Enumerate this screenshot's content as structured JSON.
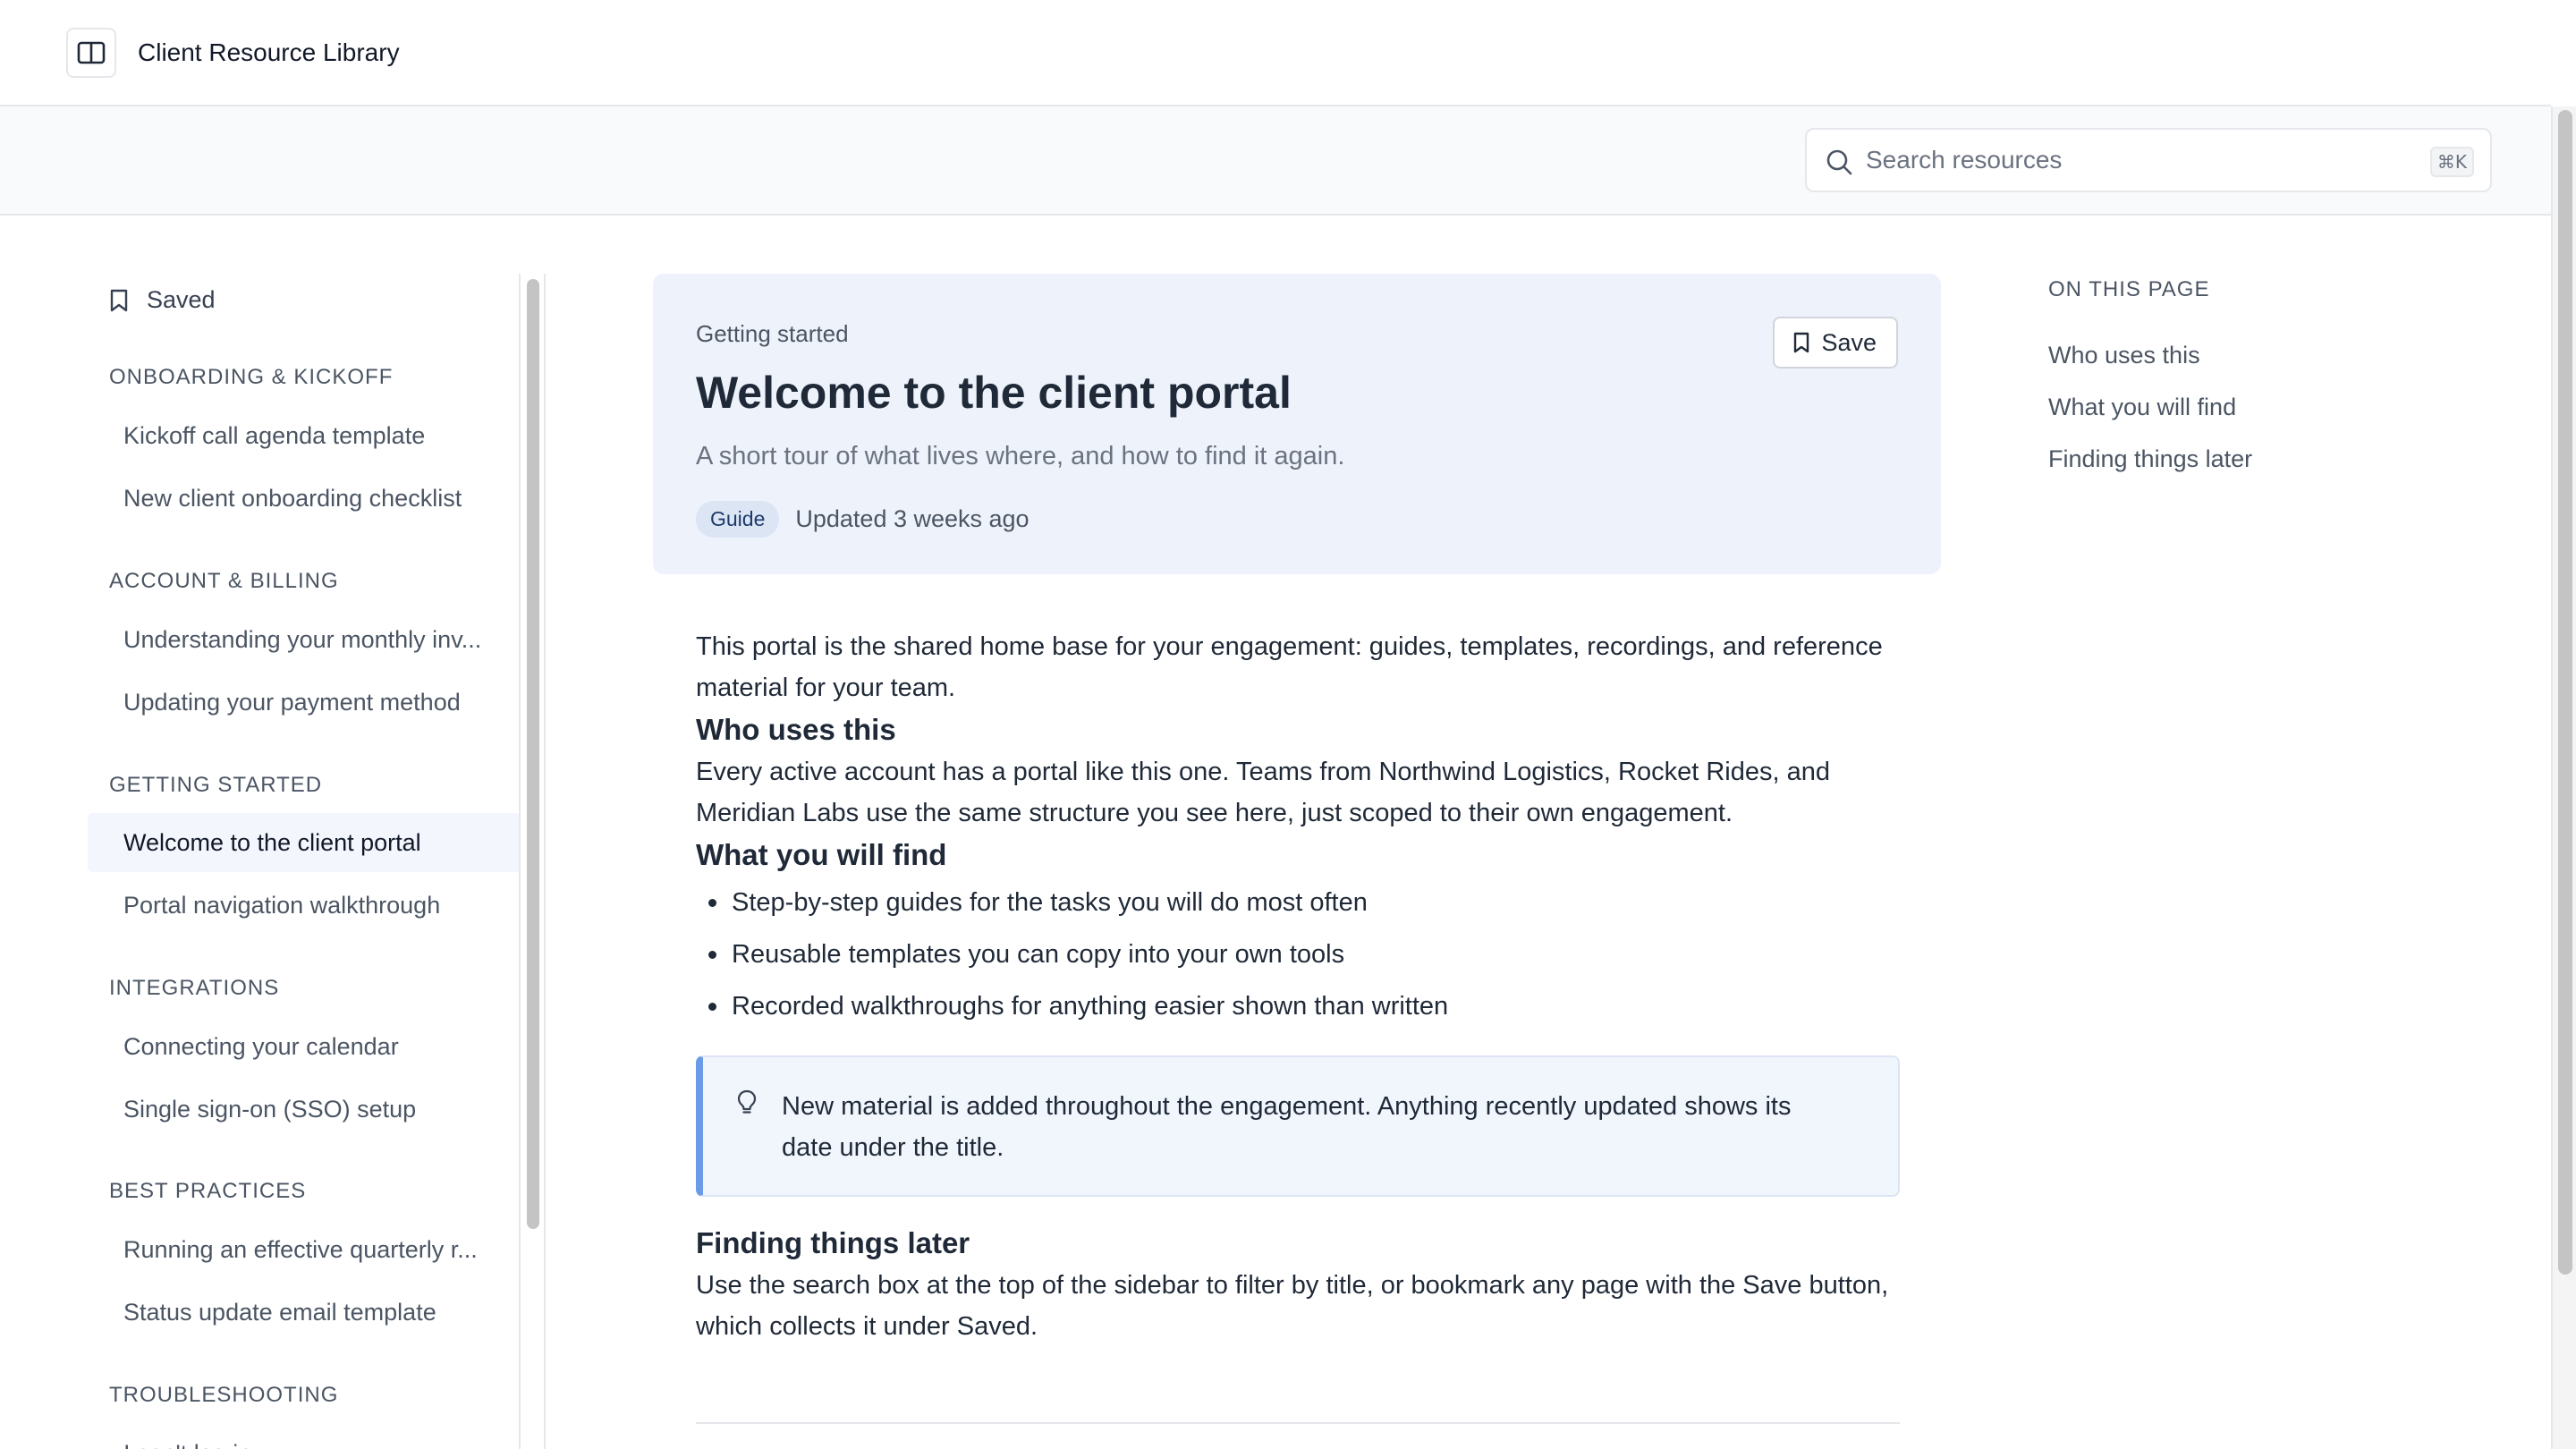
{
  "app": {
    "title": "Client Resource Library"
  },
  "search": {
    "placeholder": "Search resources",
    "shortcut": "⌘K"
  },
  "sidebar": {
    "saved_label": "Saved",
    "sections": [
      {
        "heading": "ONBOARDING & KICKOFF",
        "items": [
          "Kickoff call agenda template",
          "New client onboarding checklist"
        ]
      },
      {
        "heading": "ACCOUNT & BILLING",
        "items": [
          "Understanding your monthly inv...",
          "Updating your payment method"
        ]
      },
      {
        "heading": "GETTING STARTED",
        "items": [
          "Welcome to the client portal",
          "Portal navigation walkthrough"
        ]
      },
      {
        "heading": "INTEGRATIONS",
        "items": [
          "Connecting your calendar",
          "Single sign-on (SSO) setup"
        ]
      },
      {
        "heading": "BEST PRACTICES",
        "items": [
          "Running an effective quarterly r...",
          "Status update email template"
        ]
      },
      {
        "heading": "TROUBLESHOOTING",
        "items": [
          "I can't log in"
        ]
      }
    ],
    "active_item": "Welcome to the client portal"
  },
  "page": {
    "breadcrumb": "Getting started",
    "title": "Welcome to the client portal",
    "subtitle": "A short tour of what lives where, and how to find it again.",
    "badge": "Guide",
    "updated": "Updated 3 weeks ago",
    "save_label": "Save"
  },
  "article": {
    "intro": "This portal is the shared home base for your engagement: guides, templates, recordings, and reference material for your team.",
    "who_heading": "Who uses this",
    "who_body": "Every active account has a portal like this one. Teams from Northwind Logistics, Rocket Rides, and Meridian Labs use the same structure you see here, just scoped to their own engagement.",
    "find_heading": "What you will find",
    "find_items": [
      "Step-by-step guides for the tasks you will do most often",
      "Reusable templates you can copy into your own tools",
      "Recorded walkthroughs for anything easier shown than written"
    ],
    "callout": "New material is added throughout the engagement. Anything recently updated shows its date under the title.",
    "later_heading": "Finding things later",
    "later_body": "Use the search box at the top of the sidebar to filter by title, or bookmark any page with the Save button, which collects it under Saved."
  },
  "toc": {
    "heading": "ON THIS PAGE",
    "links": [
      "Who uses this",
      "What you will find",
      "Finding things later"
    ]
  },
  "colors": {
    "accent": "#6b9be6",
    "hero_bg": "#eef3fb",
    "badge_bg": "#dbe5f4",
    "active_nav_bg": "#f3f6fc"
  }
}
